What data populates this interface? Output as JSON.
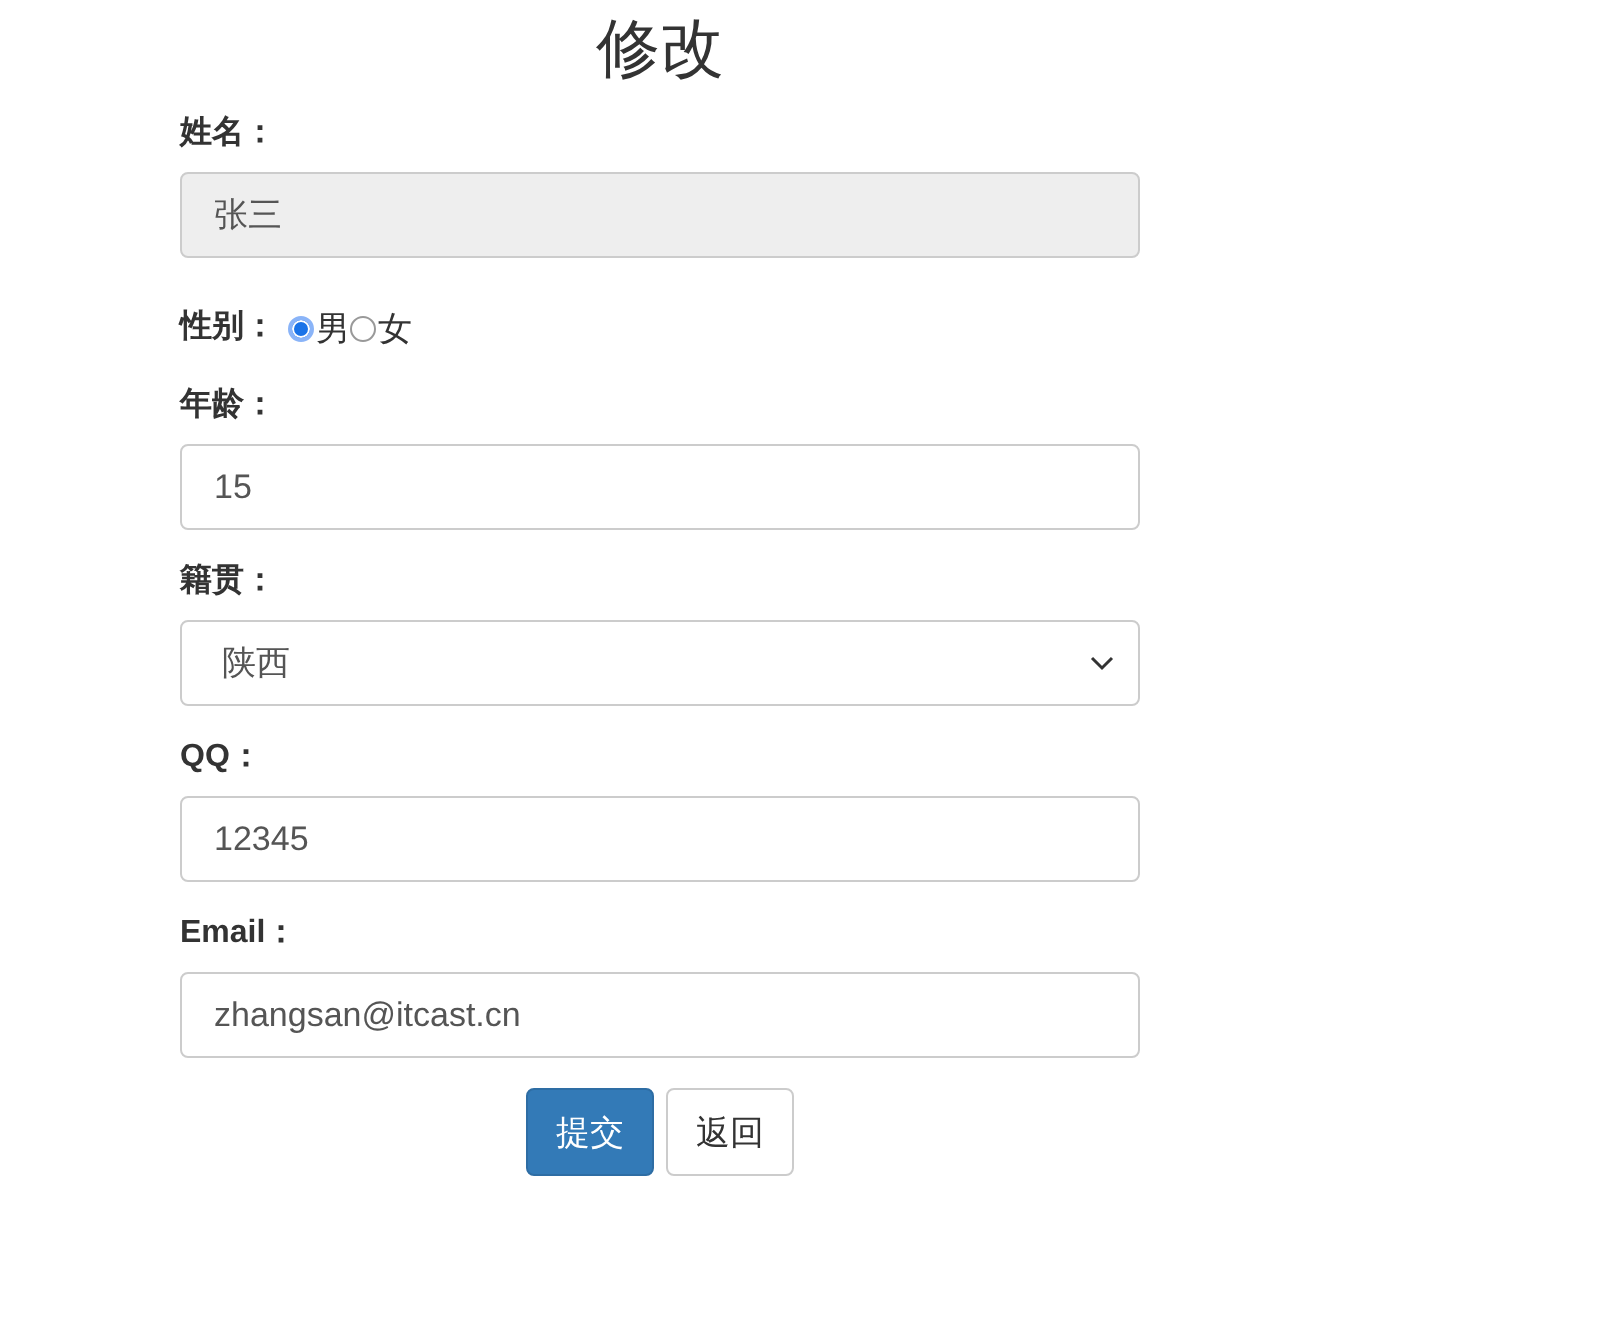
{
  "title": "修改",
  "fields": [
    {
      "kind": "text",
      "label": "姓名：",
      "value": "张三",
      "disabled": true
    },
    {
      "kind": "radio",
      "label": "性别：",
      "options": [
        {
          "label": "男",
          "selected": true
        },
        {
          "label": "女",
          "selected": false
        }
      ]
    },
    {
      "kind": "text",
      "label": "年龄：",
      "value": "15",
      "disabled": false
    },
    {
      "kind": "select",
      "label": "籍贯：",
      "value": "陕西"
    },
    {
      "kind": "text",
      "label": "QQ：",
      "value": "12345",
      "disabled": false
    },
    {
      "kind": "text",
      "label": "Email：",
      "value": "zhangsan@itcast.cn",
      "disabled": false
    }
  ],
  "buttons": [
    {
      "label": "提交",
      "kind": "primary"
    },
    {
      "label": "返回",
      "kind": "default"
    }
  ]
}
